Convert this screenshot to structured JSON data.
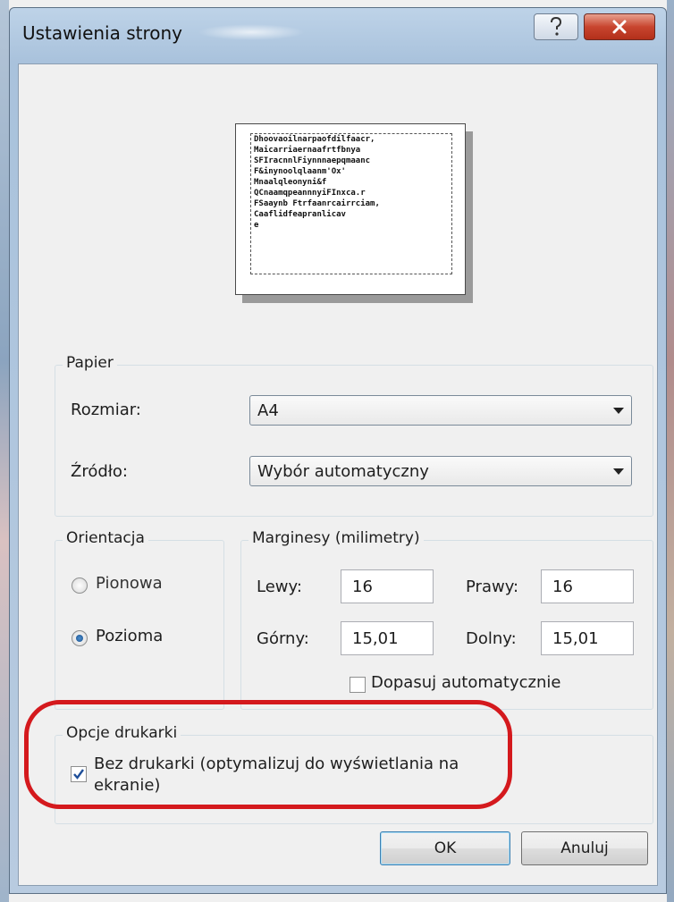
{
  "window": {
    "title": "Ustawienia strony",
    "help_symbol": "?",
    "close_symbol": "X"
  },
  "preview": {
    "lines": [
      "Dhoovaoilnarpaofdilfaacr,",
      "Maicarriaernaafrtfbnya",
      "SFIracnnlFiynnnaepqmaanc",
      "F&inynoolqlaanm'Ox'",
      "Mnaalqleonyni&f",
      "QCnaamqpeannnyiFInxca.r",
      "FSaaynb Ftrfaanrcairrciam,",
      "Caaflidfeapranlicav",
      "e"
    ]
  },
  "paper": {
    "group_label": "Papier",
    "size_label": "Rozmiar:",
    "size_value": "A4",
    "source_label": "Źródło:",
    "source_value": "Wybór automatyczny"
  },
  "orientation": {
    "group_label": "Orientacja",
    "portrait_label": "Pionowa",
    "landscape_label": "Pozioma",
    "selected": "Pozioma"
  },
  "margins": {
    "group_label": "Marginesy (milimetry)",
    "left_label": "Lewy:",
    "left_value": "16",
    "right_label": "Prawy:",
    "right_value": "16",
    "top_label": "Górny:",
    "top_value": "15,01",
    "bottom_label": "Dolny:",
    "bottom_value": "15,01",
    "autofit_label": "Dopasuj automatycznie",
    "autofit_checked": false
  },
  "printer_options": {
    "group_label": "Opcje drukarki",
    "no_printer_label_line1": "Bez drukarki (optymalizuj do wyświetlania na",
    "no_printer_label_line2": "ekranie)",
    "no_printer_checked": true
  },
  "buttons": {
    "ok": "OK",
    "cancel": "Anuluj"
  },
  "colors": {
    "highlight_ring": "#d4191d",
    "close_button": "#c8452f",
    "dialog_background": "#f0f0f0"
  }
}
